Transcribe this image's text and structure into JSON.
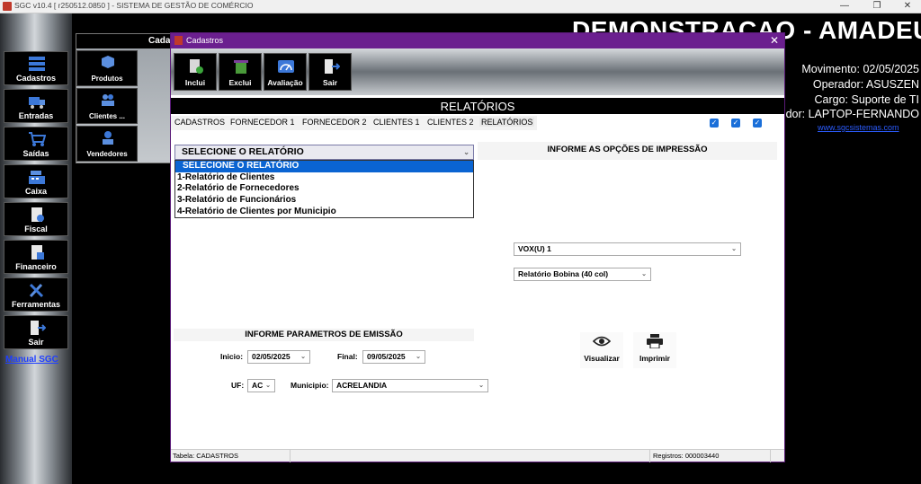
{
  "os_window": {
    "title": "SGC v10.4 [ r250512.0850 ] - SISTEMA DE GESTÃO DE COMÉRCIO",
    "minimize": "—",
    "maximize": "❐",
    "close": "✕"
  },
  "background_info": {
    "header": "DEMONSTRACAO - AMADEU",
    "movimento": "Movimento: 02/05/2025",
    "operador": "Operador: ASUSZEN",
    "cargo": "Cargo: Suporte de TI",
    "computador": "dor: LAPTOP-FERNANDO",
    "website": "www.sgcsistemas.com"
  },
  "sidebar": {
    "items": [
      {
        "label": "Cadastros",
        "icon": "database-icon"
      },
      {
        "label": "Entradas",
        "icon": "truck-icon"
      },
      {
        "label": "Saídas",
        "icon": "cart-icon"
      },
      {
        "label": "Caixa",
        "icon": "cash-register-icon"
      },
      {
        "label": "Fiscal",
        "icon": "fiscal-document-icon"
      },
      {
        "label": "Financeiro",
        "icon": "finance-document-icon"
      },
      {
        "label": "Ferramentas",
        "icon": "tools-icon"
      },
      {
        "label": "Sair",
        "icon": "exit-door-icon"
      }
    ],
    "manual_link": "Manual SGC"
  },
  "submenu": {
    "title": "Cada",
    "items": [
      {
        "label": "Produtos",
        "icon": "box-icon"
      },
      {
        "label": "Clientes ...",
        "icon": "people-icon"
      },
      {
        "label": "Vendedores",
        "icon": "seller-icon"
      }
    ]
  },
  "dialog": {
    "title": "Cadastros",
    "close": "✕",
    "toolbar": [
      {
        "label": "Inclui",
        "icon": "add-document-icon"
      },
      {
        "label": "Exclui",
        "icon": "trash-icon"
      },
      {
        "label": "Avaliação",
        "icon": "gauge-icon"
      },
      {
        "label": "Sair",
        "icon": "exit-door-icon"
      }
    ],
    "banner": "RELATÓRIOS",
    "tabs": [
      "CADASTROS",
      "FORNECEDOR 1",
      "FORNECEDOR 2",
      "CLIENTES 1",
      "CLIENTES 2",
      "RELATÓRIOS"
    ],
    "active_tab": "RELATÓRIOS",
    "checkboxes": [
      true,
      true,
      true
    ],
    "report_select": {
      "value": "SELECIONE O RELATÓRIO",
      "options": [
        "SELECIONE O RELATÓRIO",
        "1-Relatório de Clientes",
        "2-Relatório de Fornecedores",
        "3-Relatório de Funcionários",
        "4-Relatório de Clientes por Municipio"
      ],
      "selected_index": 0
    },
    "print_options": {
      "title": "INFORME AS OPÇÕES DE IMPRESSÃO",
      "printer": "VOX(U) 1",
      "format": "Relatório Bobina (40 col)"
    },
    "params": {
      "title": "INFORME PARAMETROS DE EMISSÃO",
      "inicio_label": "Inicio:",
      "inicio_value": "02/05/2025",
      "final_label": "Final:",
      "final_value": "09/05/2025",
      "uf_label": "UF:",
      "uf_value": "AC",
      "municipio_label": "Municipio:",
      "municipio_value": "ACRELANDIA"
    },
    "actions": [
      {
        "label": "Visualizar",
        "icon": "eye-icon"
      },
      {
        "label": "Imprimir",
        "icon": "printer-icon"
      }
    ],
    "status": {
      "tabela": "Tabela: CADASTROS",
      "registros": "Registros: 000003440"
    }
  },
  "colors": {
    "dialog_titlebar": "#6b1f8f",
    "dropdown_highlight": "#0a64d2",
    "link_blue": "#2b5cff"
  }
}
